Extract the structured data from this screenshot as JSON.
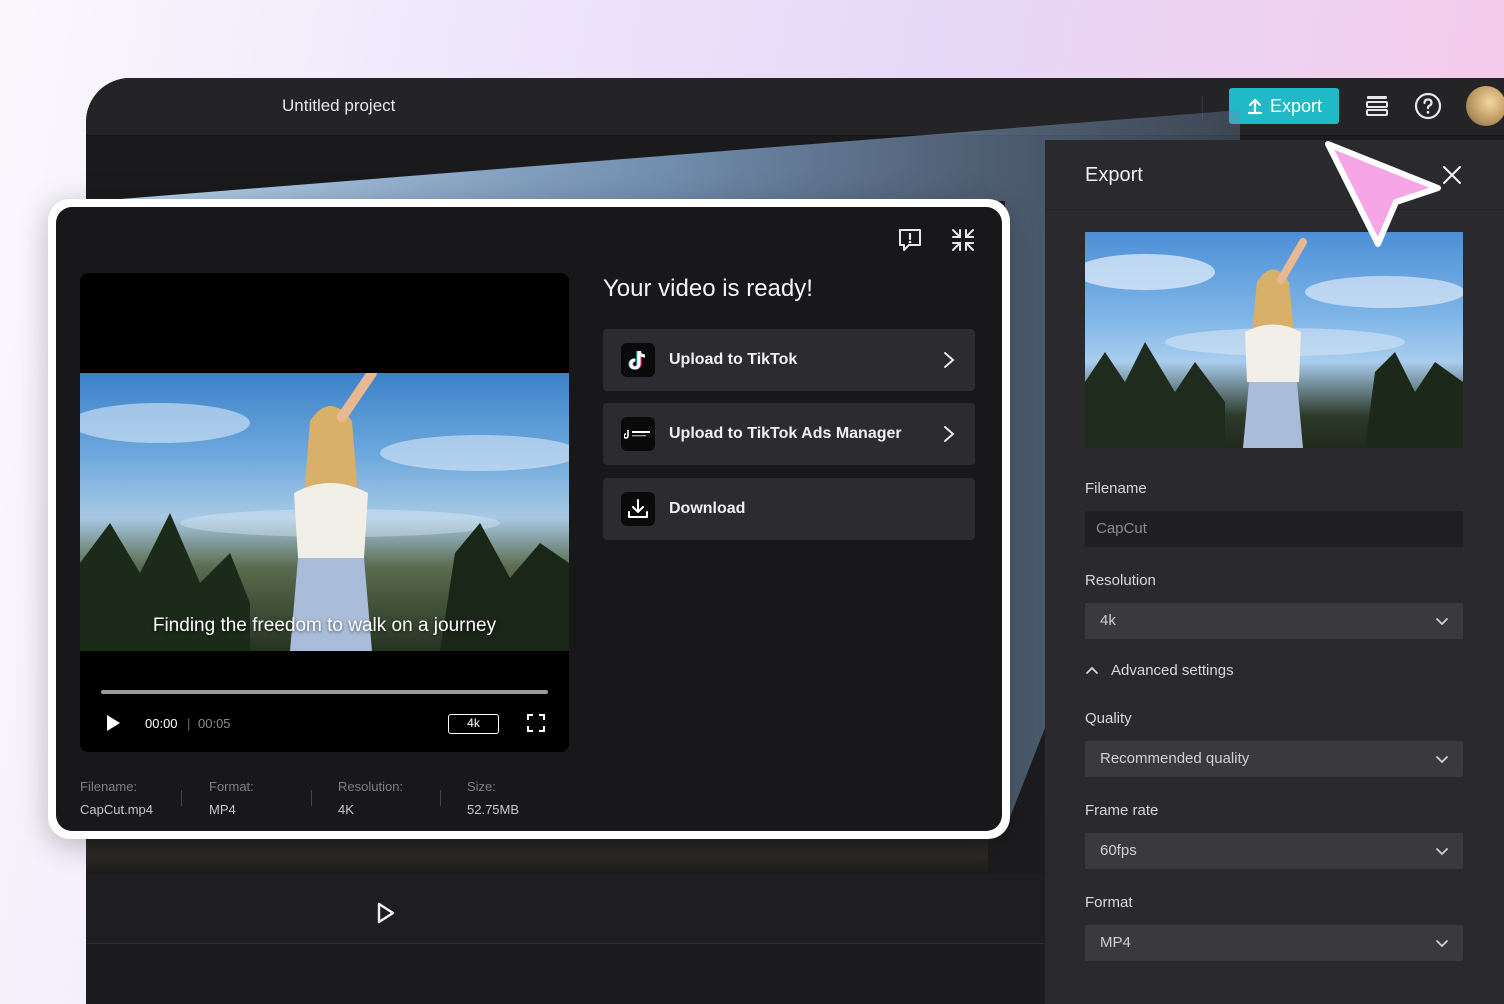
{
  "app": {
    "project_title": "Untitled project",
    "export_button_label": "Export",
    "icons": [
      "layers-icon",
      "help-icon",
      "avatar"
    ]
  },
  "export_panel": {
    "title": "Export",
    "filename_label": "Filename",
    "filename_value": "CapCut",
    "resolution_label": "Resolution",
    "resolution_value": "4k",
    "advanced_label": "Advanced settings",
    "quality_label": "Quality",
    "quality_value": "Recommended quality",
    "framerate_label": "Frame rate",
    "framerate_value": "60fps",
    "format_label": "Format",
    "format_value": "MP4"
  },
  "modal": {
    "ready_title": "Your video is ready!",
    "caption": "Finding the freedom to walk on a journey",
    "time_current": "00:00",
    "time_separator": "|",
    "time_duration": "00:05",
    "resolution_badge": "4k",
    "actions": [
      {
        "label": "Upload to TikTok",
        "icon": "tiktok-icon"
      },
      {
        "label": "Upload to TikTok Ads Manager",
        "icon": "tiktok-business-icon"
      },
      {
        "label": "Download",
        "icon": "download-icon"
      }
    ],
    "meta": {
      "filename_label": "Filename:",
      "filename_value": "CapCut.mp4",
      "format_label": "Format:",
      "format_value": "MP4",
      "resolution_label": "Resolution:",
      "resolution_value": "4K",
      "size_label": "Size:",
      "size_value": "52.75MB"
    }
  },
  "colors": {
    "accent": "#1fb9c8",
    "cursor": "#f6a6e6",
    "panel_bg": "#2a2a2e",
    "modal_bg": "#18181b"
  }
}
